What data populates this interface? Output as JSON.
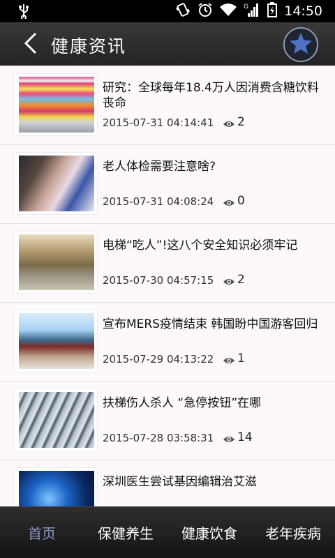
{
  "status_bar": {
    "time": "14:50"
  },
  "header": {
    "title": "健康资讯"
  },
  "articles": [
    {
      "title": "研究：全球每年18.4万人因消费含糖饮料丧命",
      "date": "2015-07-31 04:14:41",
      "views": "2"
    },
    {
      "title": "老人体检需要注意啥?",
      "date": "2015-07-31 04:08:24",
      "views": "0"
    },
    {
      "title": "电梯“吃人”!这八个安全知识必须牢记",
      "date": "2015-07-30 04:57:15",
      "views": "2"
    },
    {
      "title": "宣布MERS疫情结束 韩国盼中国游客回归",
      "date": "2015-07-29 04:13:22",
      "views": "1"
    },
    {
      "title": "扶梯伤人杀人 “急停按钮”在哪",
      "date": "2015-07-28 03:58:31",
      "views": "14"
    },
    {
      "title": "深圳医生尝试基因编辑治艾滋",
      "date": "",
      "views": ""
    }
  ],
  "tabs": [
    {
      "label": "首页",
      "active": true
    },
    {
      "label": "保健养生",
      "active": false
    },
    {
      "label": "健康饮食",
      "active": false
    },
    {
      "label": "老年疾病",
      "active": false
    }
  ],
  "colors": {
    "active_tab": "#8e9bc6",
    "header_bg": "#2d2d2d",
    "star": "#4f72c4"
  }
}
